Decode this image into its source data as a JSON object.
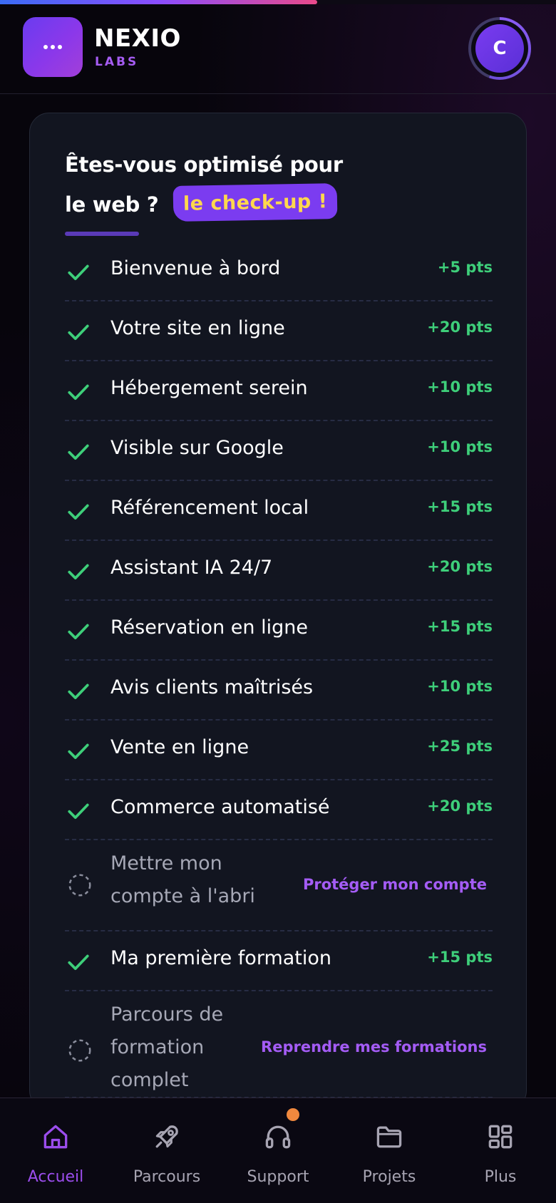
{
  "brand": {
    "name": "NEXIO",
    "sub": "LABS",
    "logo_icon": "more-dots-icon"
  },
  "top_progress": {
    "fraction": 0.57,
    "colors": [
      "#3b6cf4",
      "#8a4dff",
      "#e94a8a"
    ]
  },
  "user": {
    "avatar_initial": "C"
  },
  "checkup": {
    "title": "Êtes-vous optimisé pour le web ?",
    "badge": "le check-up !",
    "items": [
      {
        "label": "Bienvenue à bord",
        "points": "+5 pts",
        "done": true
      },
      {
        "label": "Votre site en ligne",
        "points": "+20 pts",
        "done": true
      },
      {
        "label": "Hébergement serein",
        "points": "+10 pts",
        "done": true
      },
      {
        "label": "Visible sur Google",
        "points": "+10 pts",
        "done": true
      },
      {
        "label": "Référencement local",
        "points": "+15 pts",
        "done": true
      },
      {
        "label": "Assistant IA 24/7",
        "points": "+20 pts",
        "done": true
      },
      {
        "label": "Réservation en ligne",
        "points": "+15 pts",
        "done": true
      },
      {
        "label": "Avis clients maîtrisés",
        "points": "+10 pts",
        "done": true
      },
      {
        "label": "Vente en ligne",
        "points": "+25 pts",
        "done": true
      },
      {
        "label": "Commerce automatisé",
        "points": "+20 pts",
        "done": true
      },
      {
        "label": "Mettre mon compte à l'abri",
        "label_lines": [
          "Mettre mon",
          "compte à l'abri"
        ],
        "action": "Protéger mon compte",
        "done": false
      },
      {
        "label": "Ma première formation",
        "points": "+15 pts",
        "done": true
      },
      {
        "label": "Parcours de formation complet",
        "label_lines": [
          "Parcours de",
          "formation",
          "complet"
        ],
        "action": "Reprendre mes formations",
        "done": false
      }
    ]
  },
  "bottom_nav": {
    "items": [
      {
        "label": "Accueil",
        "icon": "home-icon",
        "active": true
      },
      {
        "label": "Parcours",
        "icon": "rocket-icon",
        "active": false
      },
      {
        "label": "Support",
        "icon": "headphones-icon",
        "active": false,
        "notification": true
      },
      {
        "label": "Projets",
        "icon": "folder-icon",
        "active": false
      },
      {
        "label": "Plus",
        "icon": "grid-icon",
        "active": false
      }
    ]
  },
  "colors": {
    "accent": "#9b4dec",
    "success": "#3ecf7a",
    "badge_bg": "#7b3cf0",
    "badge_text": "#ffd84d",
    "notification": "#f0883e"
  }
}
